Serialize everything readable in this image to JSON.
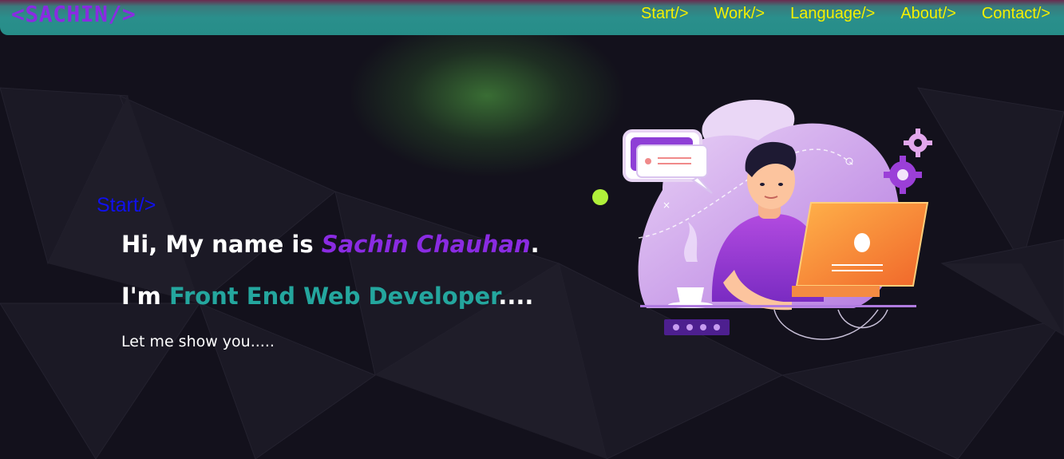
{
  "navbar": {
    "logo": "<SACHIN/>",
    "links": [
      {
        "label": "Start/>"
      },
      {
        "label": "Work/>"
      },
      {
        "label": "Language/>"
      },
      {
        "label": "About/>"
      },
      {
        "label": "Contact/>"
      }
    ]
  },
  "hero": {
    "section_label": "Start/>",
    "line1_prefix": "Hi, My name is ",
    "line1_name": "Sachin Chauhan",
    "line1_suffix": ".",
    "line2_prefix": "I'm ",
    "line2_role": "Front End Web Developer",
    "line2_suffix": "....",
    "tagline": "Let me show you....."
  },
  "colors": {
    "background": "#13111c",
    "navbar": "#268d88",
    "logo": "#8a2be2",
    "nav_link": "#f4f000",
    "section_label": "#1010ee",
    "name_accent": "#8a2be2",
    "role_accent": "#24a69e",
    "dot": "#b0f03a"
  },
  "illustration": {
    "icon": "developer-at-laptop-illustration"
  }
}
